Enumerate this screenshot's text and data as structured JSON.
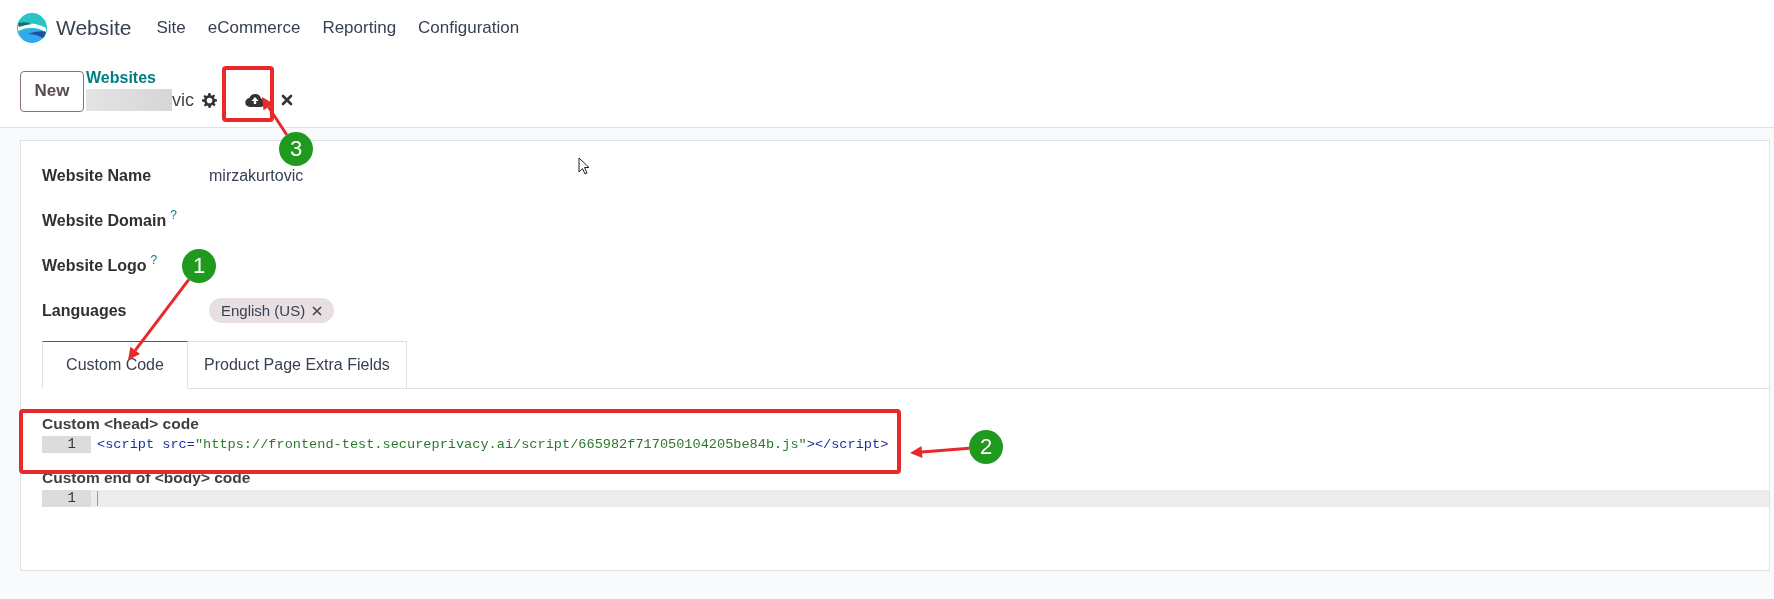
{
  "app": {
    "name": "Website",
    "menu": [
      "Site",
      "eCommerce",
      "Reporting",
      "Configuration"
    ]
  },
  "control_panel": {
    "new_button": "New",
    "breadcrumb": "Websites",
    "record_name": "vic"
  },
  "form": {
    "fields": [
      {
        "kind": "text",
        "label": "Website Name",
        "value": "mirzakurtovic"
      },
      {
        "kind": "text",
        "label": "Website Domain",
        "help": "?"
      },
      {
        "kind": "text",
        "label": "Website Logo",
        "help": "?"
      },
      {
        "kind": "tags",
        "label": "Languages",
        "tags": [
          "English (US)"
        ]
      }
    ],
    "tabs": [
      {
        "label": "Custom Code",
        "selected": true
      },
      {
        "label": "Product Page Extra Fields",
        "selected": false
      }
    ],
    "code_fields": [
      {
        "label": "Custom <head> code",
        "lines": [
          {
            "number": "1",
            "text": "<script src=\"https://frontend-test.secureprivacy.ai/script/665982f717050104205be84b.js\"></script>"
          }
        ]
      },
      {
        "label": "Custom end of <body> code",
        "lines": [
          {
            "number": "1"
          }
        ]
      }
    ]
  },
  "annotations": [
    "3",
    "1",
    "2"
  ]
}
